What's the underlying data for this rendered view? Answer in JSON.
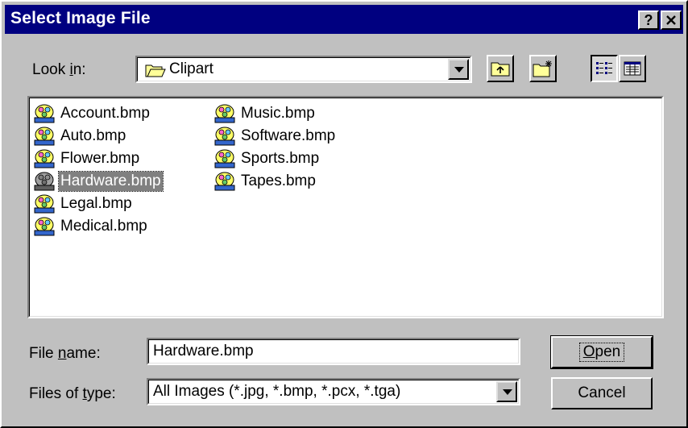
{
  "window": {
    "title": "Select Image File",
    "help_glyph": "?",
    "close_glyph": "✕"
  },
  "look_in": {
    "label_pre": "Look ",
    "label_mnemonic": "i",
    "label_post": "n:",
    "value": "Clipart",
    "icon": "folder-open-icon"
  },
  "toolbar": {
    "up_folder_icon": "up-folder-icon",
    "new_folder_icon": "new-folder-icon",
    "list_view_icon": "list-view-icon",
    "details_view_icon": "details-view-icon",
    "active_view": "list"
  },
  "file_list": {
    "items": [
      {
        "name": "Account.bmp",
        "selected": false
      },
      {
        "name": "Auto.bmp",
        "selected": false
      },
      {
        "name": "Flower.bmp",
        "selected": false
      },
      {
        "name": "Hardware.bmp",
        "selected": true
      },
      {
        "name": "Legal.bmp",
        "selected": false
      },
      {
        "name": "Medical.bmp",
        "selected": false
      },
      {
        "name": "Music.bmp",
        "selected": false
      },
      {
        "name": "Software.bmp",
        "selected": false
      },
      {
        "name": "Sports.bmp",
        "selected": false
      },
      {
        "name": "Tapes.bmp",
        "selected": false
      }
    ]
  },
  "file_name": {
    "label_pre": "File ",
    "label_mnemonic": "n",
    "label_post": "ame:",
    "value": "Hardware.bmp"
  },
  "file_type": {
    "label_pre": "Files of ",
    "label_mnemonic": "t",
    "label_post": "ype:",
    "value": "All Images (*.jpg, *.bmp, *.pcx, *.tga)"
  },
  "buttons": {
    "open_mnemonic": "O",
    "open_rest": "pen",
    "cancel": "Cancel"
  },
  "colors": {
    "titlebar": "#000080",
    "face": "#c0c0c0",
    "selection": "#808080",
    "folder": "#ffff99"
  }
}
